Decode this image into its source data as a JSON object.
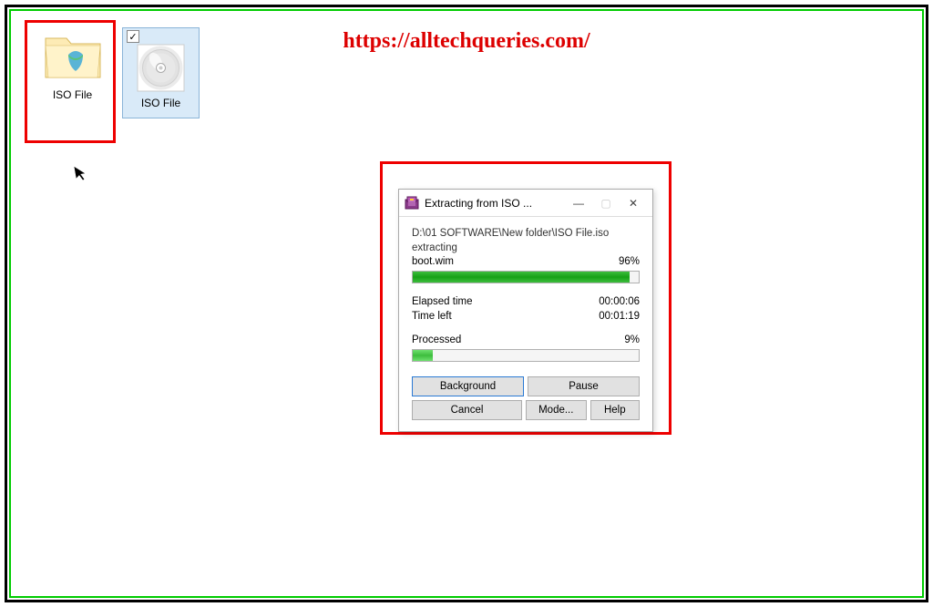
{
  "watermark": "https://alltechqueries.com/",
  "desktop": {
    "folder_label": "ISO File",
    "iso_label": "ISO File",
    "checkbox_checked": "✓"
  },
  "dialog": {
    "title": "Extracting from ISO ...",
    "path": "D:\\01 SOFTWARE\\New folder\\ISO File.iso",
    "status": "extracting",
    "current_file": "boot.wim",
    "percent1": "96%",
    "percent1_value": 96,
    "elapsed_label": "Elapsed time",
    "elapsed_value": "00:00:06",
    "timeleft_label": "Time left",
    "timeleft_value": "00:01:19",
    "processed_label": "Processed",
    "percent2": "9%",
    "percent2_value": 9,
    "buttons": {
      "background": "Background",
      "pause": "Pause",
      "cancel": "Cancel",
      "mode": "Mode...",
      "help": "Help"
    },
    "win": {
      "min": "—",
      "max": "▢",
      "close": "✕"
    }
  }
}
